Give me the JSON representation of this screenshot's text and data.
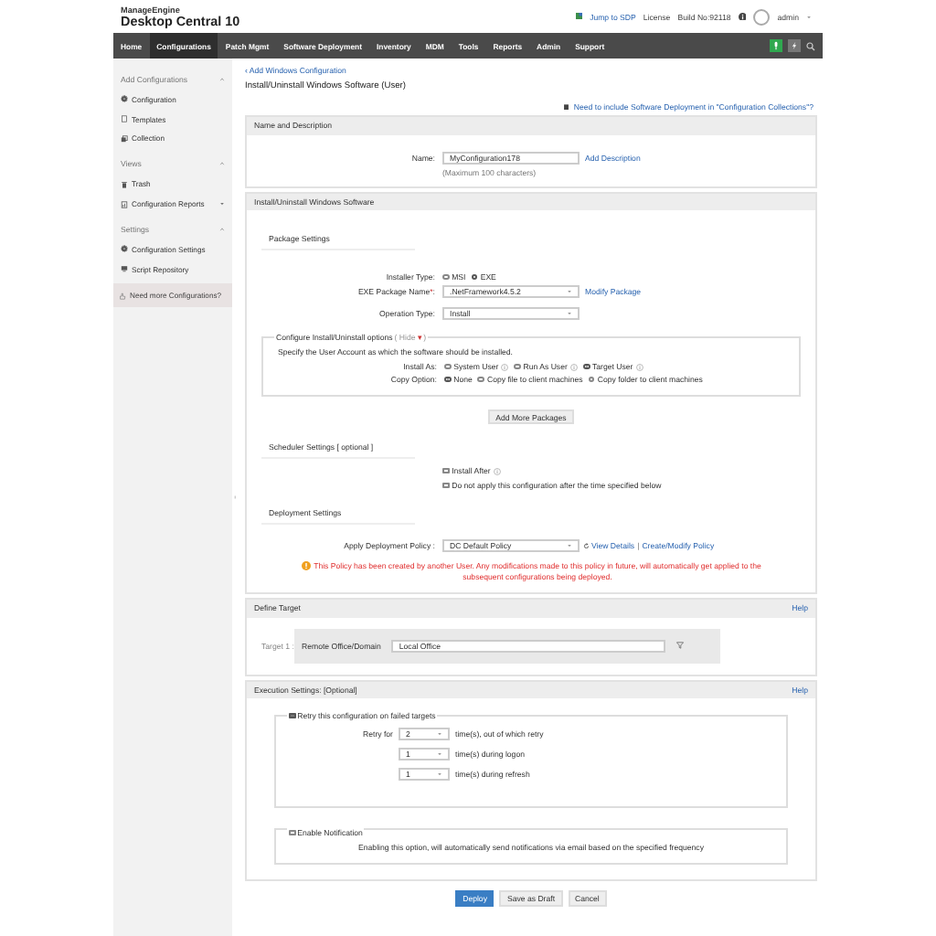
{
  "header": {
    "brand_top": "ManageEngine",
    "brand_bottom": "Desktop Central 10",
    "links": [
      "Jump to SDP",
      "License",
      "Build No:92118"
    ],
    "user": "admin"
  },
  "nav": [
    {
      "label": "Home",
      "selected": false
    },
    {
      "label": "Configurations",
      "selected": true
    },
    {
      "label": "Patch Mgmt",
      "selected": false
    },
    {
      "label": "Software Deployment",
      "selected": false
    },
    {
      "label": "Inventory",
      "selected": false
    },
    {
      "label": "MDM",
      "selected": false
    },
    {
      "label": "Tools",
      "selected": false
    },
    {
      "label": "Reports",
      "selected": false
    },
    {
      "label": "Admin",
      "selected": false
    },
    {
      "label": "Support",
      "selected": false
    }
  ],
  "sidebar": {
    "groups": [
      {
        "title": "Add Configurations",
        "expanded": true,
        "items": [
          {
            "label": "Configuration",
            "has_submenu": false
          },
          {
            "label": "Templates",
            "has_submenu": false
          },
          {
            "label": "Collection",
            "has_submenu": false
          }
        ]
      },
      {
        "title": "Views",
        "expanded": true,
        "items": [
          {
            "label": "Trash",
            "has_submenu": false
          },
          {
            "label": "Configuration Reports",
            "has_submenu": true
          }
        ]
      },
      {
        "title": "Settings",
        "expanded": true,
        "items": [
          {
            "label": "Configuration Settings",
            "has_submenu": false
          },
          {
            "label": "Script Repository",
            "has_submenu": false
          }
        ]
      }
    ],
    "promo": "Need more Configurations?"
  },
  "main": {
    "breadcrumb": "‹ Add Windows Configuration",
    "title": "Install/Uninstall Windows Software (User)",
    "collection_link": "Need to include Software Deployment in \"Configuration Collections\"?",
    "name_section": {
      "title": "Name and Description",
      "label": "Name:",
      "value": "MyConfiguration178",
      "add_description": "Add Description",
      "hint": "(Maximum 100 characters)"
    },
    "software_section": {
      "title": "Install/Uninstall Windows Software",
      "package_heading": "Package Settings",
      "installer_type": {
        "label": "Installer Type:",
        "options": [
          {
            "label": "MSI",
            "selected": false
          },
          {
            "label": "EXE",
            "selected": true
          }
        ]
      },
      "package_name": {
        "label": "EXE Package Name",
        "required_mark": "*",
        "colon": ":",
        "value": ".NetFramework4.5.2",
        "link": "Modify Package"
      },
      "operation_type": {
        "label": "Operation Type:",
        "value": "Install"
      },
      "options": {
        "legend": "Configure Install/Uninstall options",
        "toggle": "( Hide",
        "toggle_caret": "▾",
        "toggle_end": ")",
        "note": "Specify the User Account as which the software should be installed.",
        "install_as": {
          "label": "Install As:",
          "options": [
            {
              "label": "System User",
              "selected": false,
              "help": true
            },
            {
              "label": "Run As User",
              "selected": false,
              "help": true
            },
            {
              "label": "Target User",
              "selected": true,
              "help": true
            }
          ]
        },
        "copy_option": {
          "label": "Copy Option:",
          "options": [
            {
              "label": "None",
              "selected": true
            },
            {
              "label": "Copy file to client machines",
              "selected": false
            },
            {
              "label": "Copy folder to client machines",
              "selected": false
            }
          ]
        }
      },
      "add_more": "Add More Packages",
      "scheduler_heading": "Scheduler Settings [ optional ]",
      "scheduler_options": [
        {
          "label": "Install After",
          "checked": false,
          "help": true
        },
        {
          "label": "Do not apply this configuration after the time specified below",
          "checked": false,
          "help": false
        }
      ],
      "deployment_heading": "Deployment Settings",
      "policy": {
        "label": "Apply Deployment Policy :",
        "value": "DC Default Policy",
        "view": "View Details",
        "separator": "|",
        "create": "Create/Modify Policy"
      },
      "warning": "This Policy has been created by another User. Any modifications made to this policy in future, will automatically get applied to the subsequent configurations being deployed."
    },
    "target_section": {
      "title": "Define Target",
      "help": "Help",
      "target_label": "Target 1 :",
      "type": "Remote Office/Domain",
      "value": "Local Office"
    },
    "execution_section": {
      "title": "Execution Settings: [Optional]",
      "help": "Help",
      "retry": {
        "label": "Retry this configuration on failed targets",
        "checked": true,
        "rows": [
          {
            "label": "Retry for",
            "value": "2",
            "text": "time(s), out of which retry"
          },
          {
            "value": "1",
            "text": "time(s) during logon"
          },
          {
            "value": "1",
            "text": "time(s) during refresh"
          }
        ]
      },
      "notification": {
        "label": "Enable Notification",
        "checked": false,
        "note": "Enabling this option, will automatically send notifications via email based on the specified frequency"
      }
    },
    "buttons": [
      {
        "label": "Deploy",
        "kind": "primary"
      },
      {
        "label": "Save as Draft",
        "kind": "secondary"
      },
      {
        "label": "Cancel",
        "kind": "secondary"
      }
    ]
  }
}
